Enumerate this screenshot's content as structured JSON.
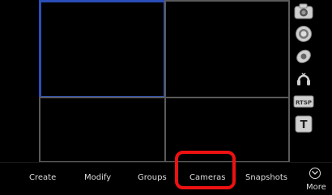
{
  "toolbar": {
    "icons": [
      "camera-icon",
      "record-icon",
      "ptz-icon",
      "audio-icon",
      "rtsp-icon",
      "text-icon"
    ],
    "rtsp_label": "RTSP",
    "text_label": "T"
  },
  "bottom_menu": {
    "items": [
      {
        "id": "create",
        "label": "Create"
      },
      {
        "id": "modify",
        "label": "Modify"
      },
      {
        "id": "groups",
        "label": "Groups"
      },
      {
        "id": "cameras",
        "label": "Cameras",
        "highlighted": true
      },
      {
        "id": "snapshots",
        "label": "Snapshots"
      }
    ],
    "more_label": "More"
  },
  "colors": {
    "selected_cell_border": "#2b4fb8",
    "highlight": "#ee1111"
  }
}
